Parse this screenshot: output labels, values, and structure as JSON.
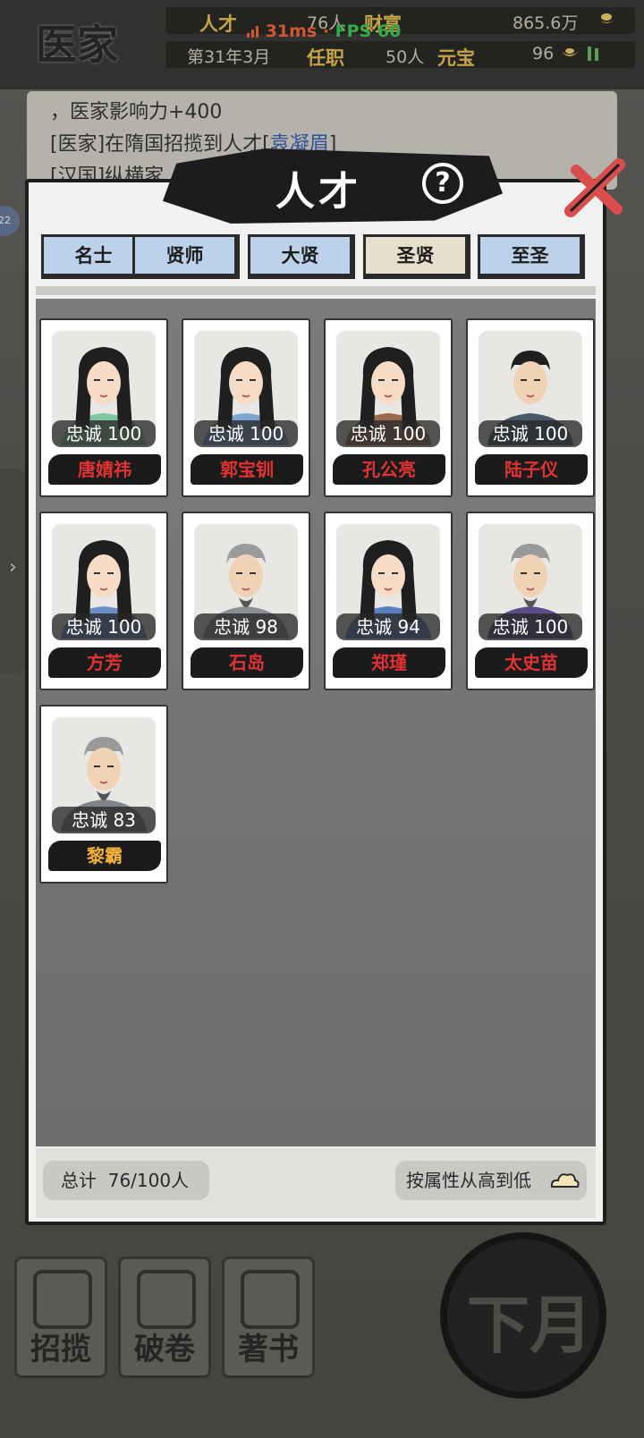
{
  "background": {
    "sect_name": "医家",
    "stats": {
      "talent_label": "人才",
      "talent_value": "76人",
      "wealth_label": "财富",
      "wealth_value": "865.6万",
      "date": "第31年3月",
      "office_label": "任职",
      "office_value": "50人",
      "ingot_label": "元宝",
      "ingot_value": "96"
    },
    "perf": {
      "ms": "31ms",
      "sep": "·",
      "fps": "FPS 60"
    },
    "log": {
      "line1": "，医家影响力+400",
      "line2_prefix": "[医家]在隋国招揽到人才[",
      "line2_name": "袁凝眉",
      "line2_suffix": "]",
      "line3": "[汉国]纵横家……医家影"
    },
    "left_badge": "22",
    "left_tab_arrow": "›",
    "actions": [
      {
        "label": "招揽",
        "icon": "recruit-scroll-icon"
      },
      {
        "label": "破卷",
        "icon": "bamboo-scroll-icon"
      },
      {
        "label": "著书",
        "icon": "brush-book-icon"
      }
    ],
    "next_month": "下月"
  },
  "dialog": {
    "title": "人才",
    "help": "?",
    "tabs": [
      {
        "label": "名士",
        "active": false
      },
      {
        "label": "贤师",
        "active": false
      },
      {
        "label": "大贤",
        "active": false
      },
      {
        "label": "圣贤",
        "active": true
      },
      {
        "label": "至圣",
        "active": false
      }
    ],
    "loyalty_label": "忠诚",
    "talents": [
      {
        "name": "唐婧祎",
        "loyalty": "100",
        "gender": "female",
        "robe": "#7fc7a0"
      },
      {
        "name": "郭宝钏",
        "loyalty": "100",
        "gender": "female",
        "robe": "#7aa6cf"
      },
      {
        "name": "孔公亮",
        "loyalty": "100",
        "gender": "female",
        "robe": "#9b6b4e"
      },
      {
        "name": "陆子仪",
        "loyalty": "100",
        "gender": "male",
        "robe": "#4b5a6b"
      },
      {
        "name": "方芳",
        "loyalty": "100",
        "gender": "female",
        "robe": "#6a8fc7"
      },
      {
        "name": "石岛",
        "loyalty": "98",
        "gender": "elder",
        "robe": "#8a8f96"
      },
      {
        "name": "郑瑾",
        "loyalty": "94",
        "gender": "female",
        "robe": "#5a7fc0"
      },
      {
        "name": "太史苗",
        "loyalty": "100",
        "gender": "elder",
        "robe": "#5b4c8a"
      },
      {
        "name": "黎霸",
        "loyalty": "83",
        "gender": "elder",
        "robe": "#7d848c",
        "highlight": true
      }
    ],
    "total_label": "总计",
    "total_value": "76/100人",
    "sort_label": "按属性从高到低"
  }
}
